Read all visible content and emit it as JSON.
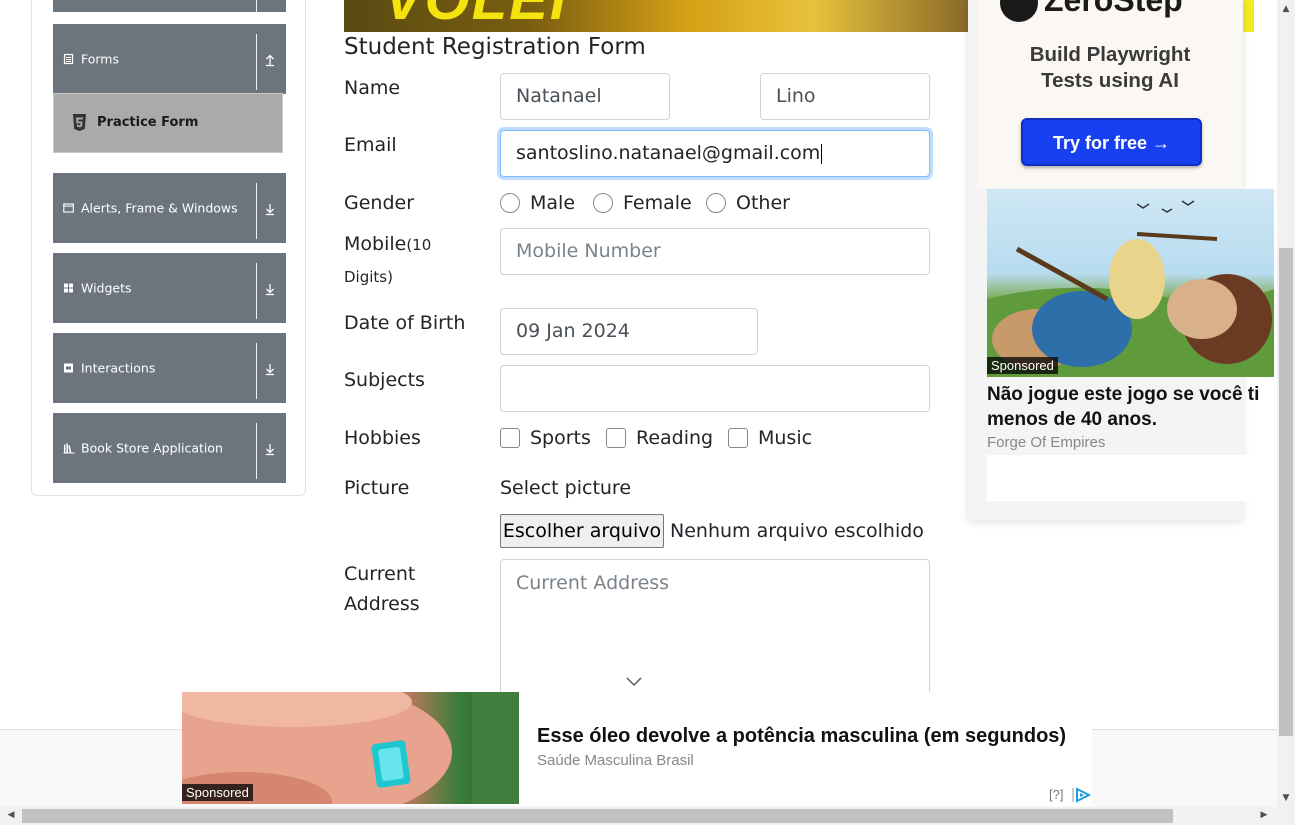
{
  "sidebar": {
    "groups": [
      {
        "label": "Forms",
        "icon": "forms-icon",
        "arrow": "collapse-arrow-icon"
      },
      {
        "label": "Alerts, Frame & Windows",
        "icon": "window-icon",
        "arrow": "expand-arrow-icon"
      },
      {
        "label": "Widgets",
        "icon": "widgets-icon",
        "arrow": "expand-arrow-icon"
      },
      {
        "label": "Interactions",
        "icon": "interactions-icon",
        "arrow": "expand-arrow-icon"
      },
      {
        "label": "Book Store Application",
        "icon": "book-icon",
        "arrow": "expand-arrow-icon"
      }
    ],
    "active_item": {
      "label": "Practice Form",
      "icon": "html5-icon"
    }
  },
  "banner": {
    "text": "VOLEI"
  },
  "form": {
    "title": "Student Registration Form",
    "name_label": "Name",
    "first_name": "Natanael",
    "last_name": "Lino",
    "email_label": "Email",
    "email_value": "santoslino.natanael@gmail.com",
    "gender_label": "Gender",
    "gender_options": [
      "Male",
      "Female",
      "Other"
    ],
    "mobile_label": "Mobile",
    "mobile_hint_1": "(10",
    "mobile_hint_2": "Digits)",
    "mobile_placeholder": "Mobile Number",
    "dob_label": "Date of Birth",
    "dob_value": "09 Jan 2024",
    "subjects_label": "Subjects",
    "subjects_value": "",
    "hobbies_label": "Hobbies",
    "hobby_options": [
      "Sports",
      "Reading",
      "Music"
    ],
    "picture_label": "Picture",
    "select_picture": "Select picture",
    "file_button": "Escolher arquivo",
    "file_status": "Nenhum arquivo escolhido",
    "address_label_1": "Current",
    "address_label_2": "Address",
    "address_placeholder": "Current Address"
  },
  "ads": {
    "zerostep": {
      "logo": "ZeroStep",
      "title_1": "Build Playwright",
      "title_2": "Tests using AI",
      "button": "Try for free →"
    },
    "game": {
      "badge": "Sponsored",
      "title_1": "Não jogue este jogo se você ti",
      "title_2": "menos de 40 anos.",
      "source": "Forge Of Empires"
    },
    "bottom": {
      "badge": "Sponsored",
      "title": "Esse óleo devolve a potência masculina (em segundos)",
      "source": "Saúde Masculina Brasil",
      "info": "[?]"
    }
  },
  "colors": {
    "sidebar_group": "#6c757d",
    "active_item": "#aaaaaa",
    "focus": "#80bdff",
    "cta": "#1840f0"
  }
}
